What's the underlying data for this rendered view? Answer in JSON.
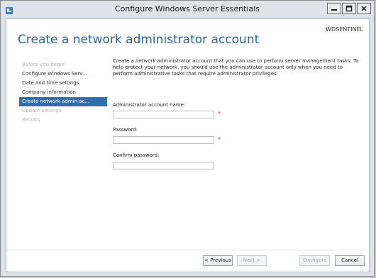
{
  "window": {
    "title": "Configure Windows Server Essentials"
  },
  "header": {
    "server_name": "WDSENTINEL",
    "page_title": "Create a network administrator account"
  },
  "sidebar": {
    "items": [
      {
        "label": "Before you begin",
        "state": "disabled"
      },
      {
        "label": "Configure Windows Serv...",
        "state": "normal"
      },
      {
        "label": "Date and time settings",
        "state": "normal"
      },
      {
        "label": "Company information",
        "state": "normal"
      },
      {
        "label": "Create network admin ac...",
        "state": "active"
      },
      {
        "label": "Update settings",
        "state": "disabled"
      },
      {
        "label": "Results",
        "state": "disabled"
      }
    ]
  },
  "form": {
    "description": "Create a network administrator account that you can use to perform server management tasks. To help protect your network, you should use the administrator account only when you need to perform administrative tasks that require administrator privileges.",
    "admin_name_label": "Administrator account name:",
    "admin_name_value": "",
    "password_label": "Password:",
    "password_value": "",
    "confirm_label": "Confirm password:",
    "confirm_value": "",
    "required_marker": "*"
  },
  "buttons": {
    "previous": "< Previous",
    "next": "Next >",
    "configure": "Configure",
    "cancel": "Cancel"
  },
  "colors": {
    "accent": "#2f6fb0",
    "title_blue": "#2a64a0",
    "required_red": "#d42a2a"
  }
}
